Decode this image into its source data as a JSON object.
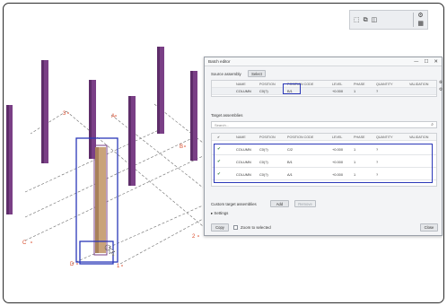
{
  "viewport": {
    "grid_labels": [
      "3",
      "A",
      "B",
      "C",
      "D",
      "1",
      "2"
    ],
    "colors": {
      "column": "#7a3f86",
      "column_selected": "#c9a37a",
      "grid_line": "#6b6b6b",
      "grid_label": "#d94b2b",
      "selection": "#2a37b8"
    }
  },
  "toolbar": {
    "icons": [
      "cube-icon",
      "layers-icon",
      "camera-icon",
      "settings-icon",
      "grid-toggle-icon"
    ]
  },
  "dialog": {
    "title": "Batch editor",
    "window_buttons": {
      "minimize": "—",
      "restore": "☐",
      "close": "✕"
    },
    "source_assembly": {
      "label": "Source assembly",
      "select_button": "Select",
      "headers": [
        "NAME",
        "POSITION",
        "POSITION CODE",
        "LEVEL",
        "PHASE",
        "QUANTITY",
        "VALIDATION"
      ],
      "rows": [
        [
          "COLUMN",
          "C0(?)",
          "B/1",
          "+0.000",
          "1",
          "?",
          ""
        ]
      ]
    },
    "target_assemblies": {
      "label": "Target assemblies",
      "search_placeholder": "Search...",
      "headers": [
        "",
        "NAME",
        "POSITION",
        "POSITION CODE",
        "LEVEL",
        "PHASE",
        "QUANTITY",
        "VALIDATION"
      ],
      "rows": [
        [
          "✔",
          "COLUMN",
          "C0(?)",
          "C/2",
          "+0.000",
          "1",
          "?",
          ""
        ],
        [
          "✔",
          "COLUMN",
          "C0(?)",
          "B/1",
          "+0.000",
          "1",
          "?",
          ""
        ],
        [
          "✔",
          "COLUMN",
          "C0(?)",
          "A/1",
          "+0.000",
          "1",
          "?",
          ""
        ]
      ]
    },
    "custom_target": {
      "label": "Custom target assemblies",
      "add_button": "Add",
      "remove_button": "Remove"
    },
    "settings_label": "▸ Settings",
    "copy_button": "Copy",
    "zoom_label": "Zoom to selected",
    "close_button": "Close"
  }
}
